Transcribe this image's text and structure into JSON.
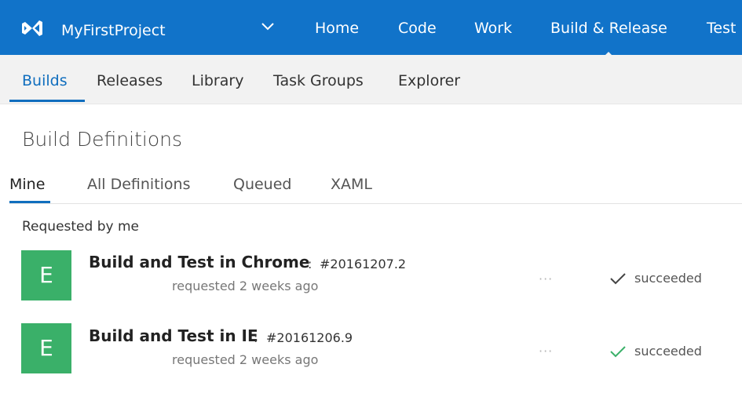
{
  "project": {
    "name": "MyFirstProject"
  },
  "topnav": {
    "items": [
      "Home",
      "Code",
      "Work",
      "Build & Release",
      "Test"
    ]
  },
  "subnav": {
    "items": [
      "Builds",
      "Releases",
      "Library",
      "Task Groups",
      "Explorer"
    ]
  },
  "page": {
    "title": "Build Definitions"
  },
  "pivots": {
    "items": [
      "Mine",
      "All Definitions",
      "Queued",
      "XAML"
    ]
  },
  "section": {
    "label": "Requested by me"
  },
  "builds": [
    {
      "avatar": "E",
      "name": "Build and Test in Chrome",
      "colon": ":",
      "number": "#20161207.2",
      "requested": "requested 2 weeks ago",
      "more": "···",
      "status": "succeeded"
    },
    {
      "avatar": "E",
      "name": "Build and Test in IE",
      "colon": ":",
      "number": "#20161206.9",
      "requested": "requested 2 weeks ago",
      "more": "···",
      "status": "succeeded"
    }
  ],
  "colors": {
    "topnav": "#1173c9",
    "accent": "#106ebe",
    "avatar": "#3ab069"
  }
}
